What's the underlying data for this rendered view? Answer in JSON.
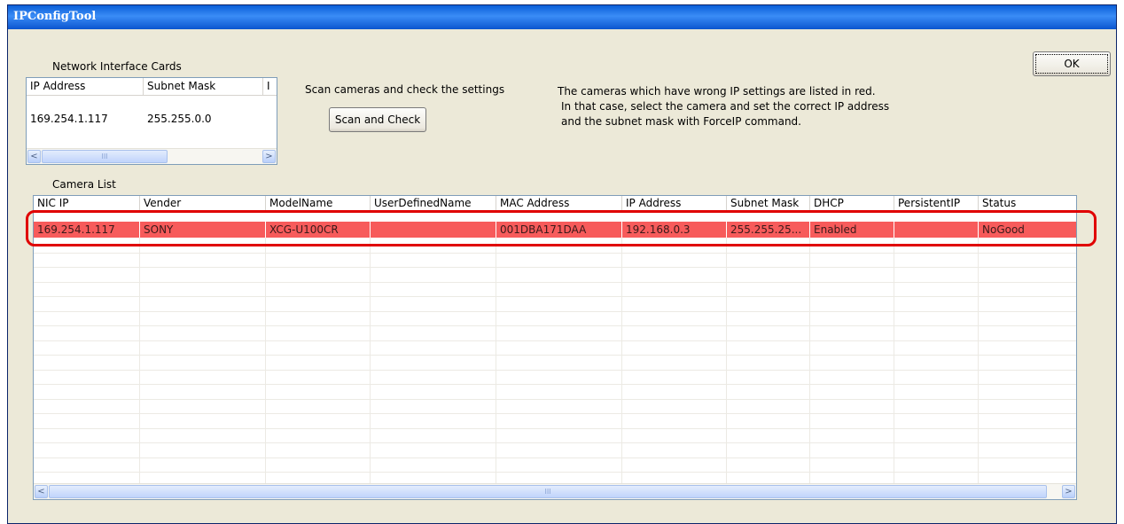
{
  "window": {
    "title": "IPConfigTool"
  },
  "nic_section": {
    "label": "Network Interface Cards",
    "columns": [
      "IP Address",
      "Subnet Mask",
      "I"
    ],
    "rows": [
      [
        "169.254.1.117",
        "255.255.0.0"
      ]
    ],
    "scroll_left": "<",
    "scroll_right": ">",
    "thumb_grip": "III"
  },
  "scan": {
    "label": "Scan cameras and check the settings",
    "button": "Scan and Check"
  },
  "info": {
    "line1": "The cameras which have wrong IP settings are listed in red.",
    "line2": "In that case, select the camera and set the correct IP address",
    "line3": "and the subnet mask with ForceIP command."
  },
  "ok_button": "OK",
  "camera_list": {
    "label": "Camera List",
    "columns": [
      "NIC IP",
      "Vender",
      "ModelName",
      "UserDefinedName",
      "MAC Address",
      "IP Address",
      "Subnet Mask",
      "DHCP",
      "PersistentIP",
      "Status"
    ],
    "rows": [
      [
        "169.254.1.117",
        "SONY",
        "XCG-U100CR",
        "",
        "001DBA171DAA",
        "192.168.0.3",
        "255.255.25...",
        "Enabled",
        "",
        "NoGood"
      ]
    ],
    "row_status_color": "#f75b5b",
    "scroll_left": "<",
    "scroll_right": ">",
    "thumb_grip": "III"
  },
  "colors": {
    "title_bar": "#0a5fd8",
    "window_background": "#ece9d8",
    "highlight_outline": "#e00000"
  }
}
